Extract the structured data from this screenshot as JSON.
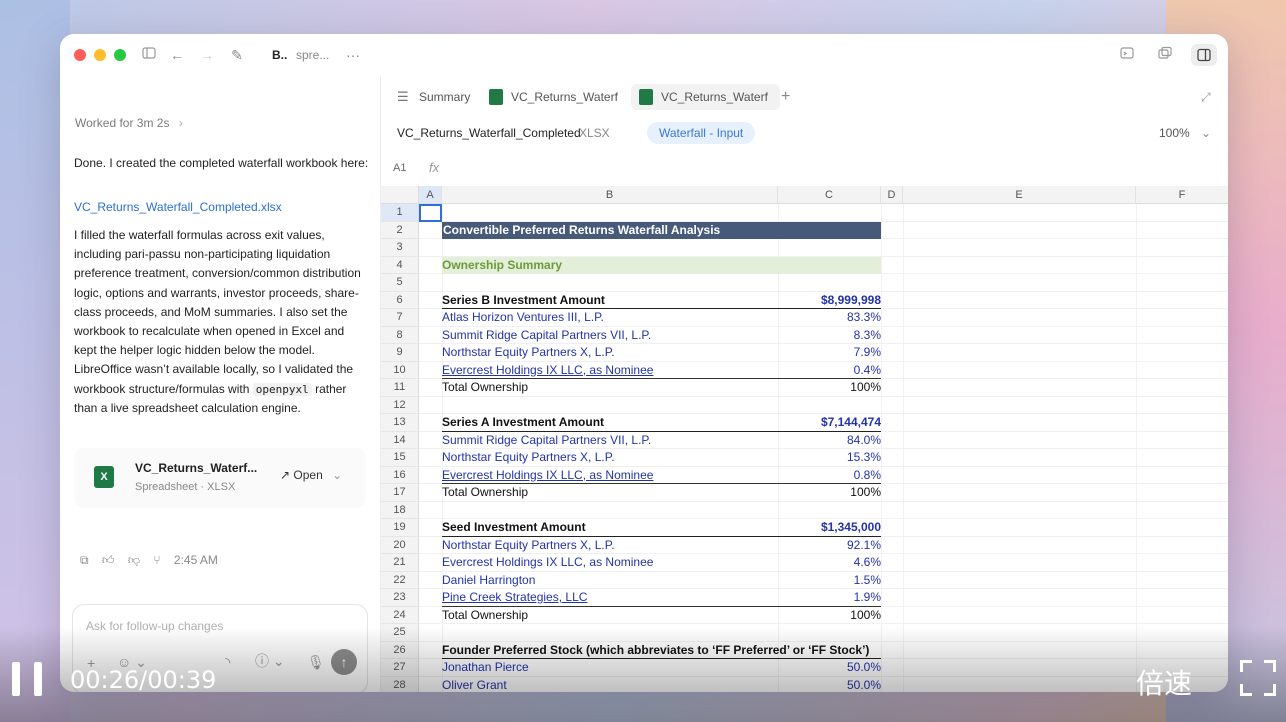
{
  "window": {
    "title_short": "B..",
    "title_sub": "spre...",
    "colors": {
      "close": "#ff5f57",
      "minimize": "#febc2e",
      "zoom": "#28c840"
    }
  },
  "chat": {
    "worked_label": "Worked for 3m 2s",
    "done_text": "Done. I created the completed waterfall workbook here:",
    "file_link": "VC_Returns_Waterfall_Completed.xlsx",
    "summary_pre": "I filled the waterfall formulas across exit values, including pari-passu non-participating liquidation preference treatment, conversion/common distribution logic, options and warrants, investor proceeds, share-class proceeds, and MoM summaries. I also set the workbook to recalculate when opened in Excel and kept the helper logic hidden below the model. LibreOffice wasn’t available locally, so I validated the workbook structure/formulas with",
    "summary_code": "openpyxl",
    "summary_post": "rather than a live spreadsheet calculation engine.",
    "file_card": {
      "name": "VC_Returns_Waterf...",
      "type": "Spreadsheet · XLSX",
      "open_label": "Open"
    },
    "timestamp": "2:45 AM",
    "composer_placeholder": "Ask for follow-up changes"
  },
  "tabs": [
    {
      "label": "Summary",
      "icon": "summary-icon"
    },
    {
      "label": "VC_Returns_Waterf",
      "icon": "excel-icon"
    },
    {
      "label": "VC_Returns_Waterf",
      "icon": "excel-icon"
    }
  ],
  "toolbar": {
    "doc_name": "VC_Returns_Waterfall_Completed",
    "doc_ext": "XLSX",
    "sheet": "Waterfall - Input",
    "zoom": "100%"
  },
  "formula_bar": {
    "cell_ref": "A1",
    "fx": "fx"
  },
  "columns": [
    "A",
    "B",
    "C",
    "D",
    "E",
    "F"
  ],
  "row_numbers": [
    "1",
    "2",
    "3",
    "4",
    "5",
    "6",
    "7",
    "8",
    "9",
    "10",
    "11",
    "12",
    "13",
    "14",
    "15",
    "16",
    "17",
    "18",
    "19",
    "20",
    "21",
    "22",
    "23",
    "24",
    "25",
    "26",
    "27",
    "28"
  ],
  "rows": [
    {
      "b": "",
      "c": "",
      "style": ""
    },
    {
      "b": "Convertible Preferred Returns Waterfall Analysis",
      "c": "",
      "style": "title"
    },
    {
      "b": "",
      "c": "",
      "style": ""
    },
    {
      "b": "Ownership Summary",
      "c": "",
      "style": "section"
    },
    {
      "b": "",
      "c": "",
      "style": ""
    },
    {
      "b": "Series B Investment Amount",
      "c": "$8,999,998",
      "style": "header"
    },
    {
      "b": "Atlas Horizon Ventures III, L.P.",
      "c": "83.3%",
      "style": "blue"
    },
    {
      "b": "Summit Ridge Capital Partners VII, L.P.",
      "c": "8.3%",
      "style": "blue"
    },
    {
      "b": "Northstar Equity Partners X, L.P.",
      "c": "7.9%",
      "style": "blue"
    },
    {
      "b": "Evercrest Holdings IX LLC, as Nominee",
      "c": "0.4%",
      "style": "blue-ul"
    },
    {
      "b": "Total Ownership",
      "c": "100%",
      "style": "total"
    },
    {
      "b": "",
      "c": "",
      "style": ""
    },
    {
      "b": "Series A Investment Amount",
      "c": "$7,144,474",
      "style": "header"
    },
    {
      "b": "Summit Ridge Capital Partners VII, L.P.",
      "c": "84.0%",
      "style": "blue"
    },
    {
      "b": "Northstar Equity Partners X, L.P.",
      "c": "15.3%",
      "style": "blue"
    },
    {
      "b": "Evercrest Holdings IX LLC, as Nominee",
      "c": "0.8%",
      "style": "blue-ul"
    },
    {
      "b": "Total Ownership",
      "c": "100%",
      "style": "total"
    },
    {
      "b": "",
      "c": "",
      "style": ""
    },
    {
      "b": "Seed Investment Amount",
      "c": "$1,345,000",
      "style": "header"
    },
    {
      "b": "Northstar Equity Partners X, L.P.",
      "c": "92.1%",
      "style": "blue"
    },
    {
      "b": "Evercrest Holdings IX LLC, as Nominee",
      "c": "4.6%",
      "style": "blue"
    },
    {
      "b": "Daniel Harrington",
      "c": "1.5%",
      "style": "blue"
    },
    {
      "b": "Pine Creek Strategies, LLC",
      "c": "1.9%",
      "style": "blue-ul"
    },
    {
      "b": "Total Ownership",
      "c": "100%",
      "style": "total"
    },
    {
      "b": "",
      "c": "",
      "style": ""
    },
    {
      "b": "Founder Preferred Stock (which abbreviates to ‘FF Preferred’ or ‘FF Stock’)",
      "c": "",
      "style": "header"
    },
    {
      "b": "Jonathan Pierce",
      "c": "50.0%",
      "style": "blue"
    },
    {
      "b": "Oliver Grant",
      "c": "50.0%",
      "style": "blue"
    }
  ],
  "video": {
    "time": "00:26/00:39",
    "speed_label": "倍速"
  }
}
